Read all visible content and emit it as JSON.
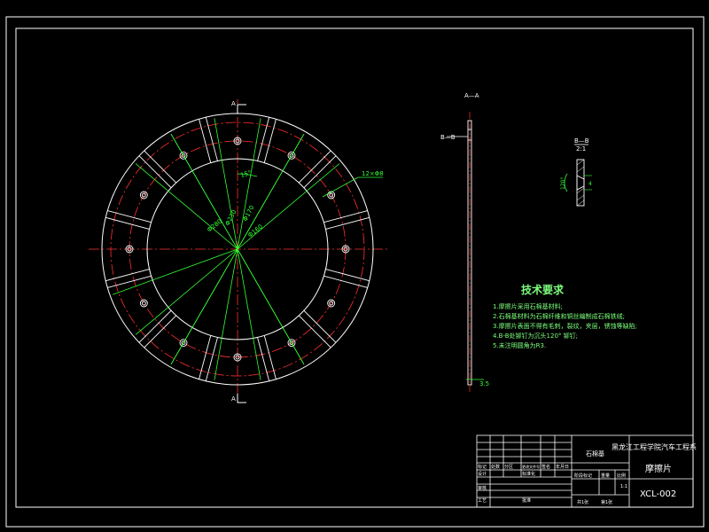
{
  "drawing": {
    "colors": {
      "background": "#000000",
      "outline": "#ffffff",
      "centerline": "#ff3030",
      "dimension": "#33ff33",
      "note_text": "#7cff7c"
    },
    "section_labels": {
      "aa_top": "A",
      "aa_bottom": "A",
      "side_view_title": "A—A",
      "bb_callout": "B—B",
      "detail_title": "B—B",
      "detail_scale": "2:1"
    },
    "dimensions": {
      "d_outer": "Φ280",
      "d_bolt": "Φ230",
      "d_inner": "Φ160",
      "d_hole": "Φ170",
      "angle": "15°",
      "hole_count": "12×Φ8",
      "thickness": "3.5",
      "detail_dim1": "120°",
      "detail_dim2": "4"
    },
    "tech_requirements": {
      "title": "技术要求",
      "items": [
        "1.摩擦片采用石棉基材料;",
        "2.石棉基材料为石棉纤维和铜丝编制成石棉铁绒;",
        "3.摩擦片表面不得有毛刺，裂纹，夹层，锈蚀等缺陷;",
        "4.B-B处铆钉为沉头120° 铆钉;",
        "5.未注明圆角为R3."
      ]
    },
    "title_block": {
      "school": "黑龙江工程学院汽车工程系",
      "material": "石棉基",
      "part_name": "摩擦片",
      "drawing_no": "XCL-002",
      "scale": "1:1",
      "mark_labels": [
        "阶段标记",
        "重量",
        "比例"
      ],
      "sheet_total": "共1张",
      "sheet_no": "第1张",
      "revision_headers": [
        "标记",
        "处数",
        "分区",
        "更改文件号",
        "签名",
        "年月日"
      ],
      "design_label": "设计",
      "review_label": "审核",
      "process_label": "工艺",
      "approve_label": "批准",
      "standard_label": "标准化"
    }
  }
}
